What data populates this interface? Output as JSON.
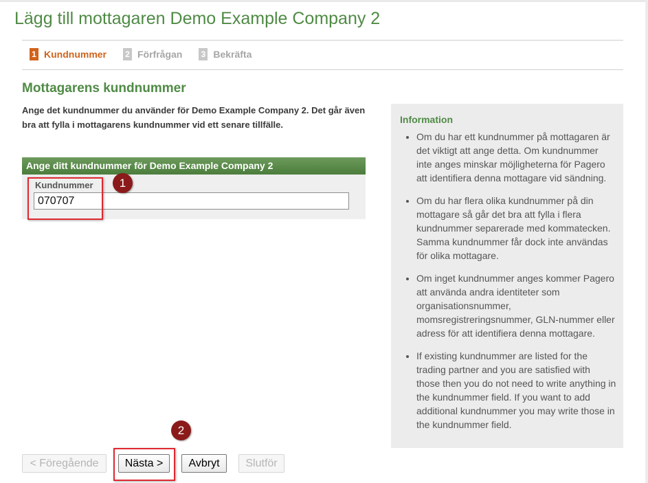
{
  "page": {
    "title": "Lägg till mottagaren Demo Example Company 2"
  },
  "steps": [
    {
      "number": "1",
      "label": "Kundnummer",
      "active": true
    },
    {
      "number": "2",
      "label": "Förfrågan",
      "active": false
    },
    {
      "number": "3",
      "label": "Bekräfta",
      "active": false
    }
  ],
  "main": {
    "heading": "Mottagarens kundnummer",
    "intro": "Ange det kundnummer du använder för Demo Example Company 2. Det går även bra att fylla i mottagarens kundnummer vid ett senare tillfälle.",
    "form": {
      "header": "Ange ditt kundnummer för Demo Example Company 2",
      "field_label": "Kundnummer",
      "field_value": "070707"
    }
  },
  "info": {
    "title": "Information",
    "items": [
      "Om du har ett kundnummer på mottagaren är det viktigt att ange detta. Om kundnummer inte anges minskar möjligheterna för Pagero att identifiera denna mottagare vid sändning.",
      "Om du har flera olika kundnummer på din mottagare så går det bra att fylla i flera kundnummer separerade med kommatecken. Samma kundnummer får dock inte användas för olika mottagare.",
      "Om inget kundnummer anges kommer Pagero att använda andra identiteter som organisationsnummer, momsregistreringsnummer, GLN-nummer eller adress för att identifiera denna mottagare.",
      "If existing kundnummer are listed for the trading partner and you are satisfied with those then you do not need to write anything in the kundnummer field. If you want to add additional kundnummer you may write those in the kundnummer field."
    ]
  },
  "buttons": {
    "prev": "< Föregående",
    "next": "Nästa >",
    "cancel": "Avbryt",
    "finish": "Slutför"
  },
  "annotations": {
    "badge1": "1",
    "badge2": "2"
  },
  "colors": {
    "accent_green": "#4f8a45",
    "active_step": "#d0631b",
    "highlight_red": "#e0282f",
    "badge": "#8b1a1a"
  }
}
